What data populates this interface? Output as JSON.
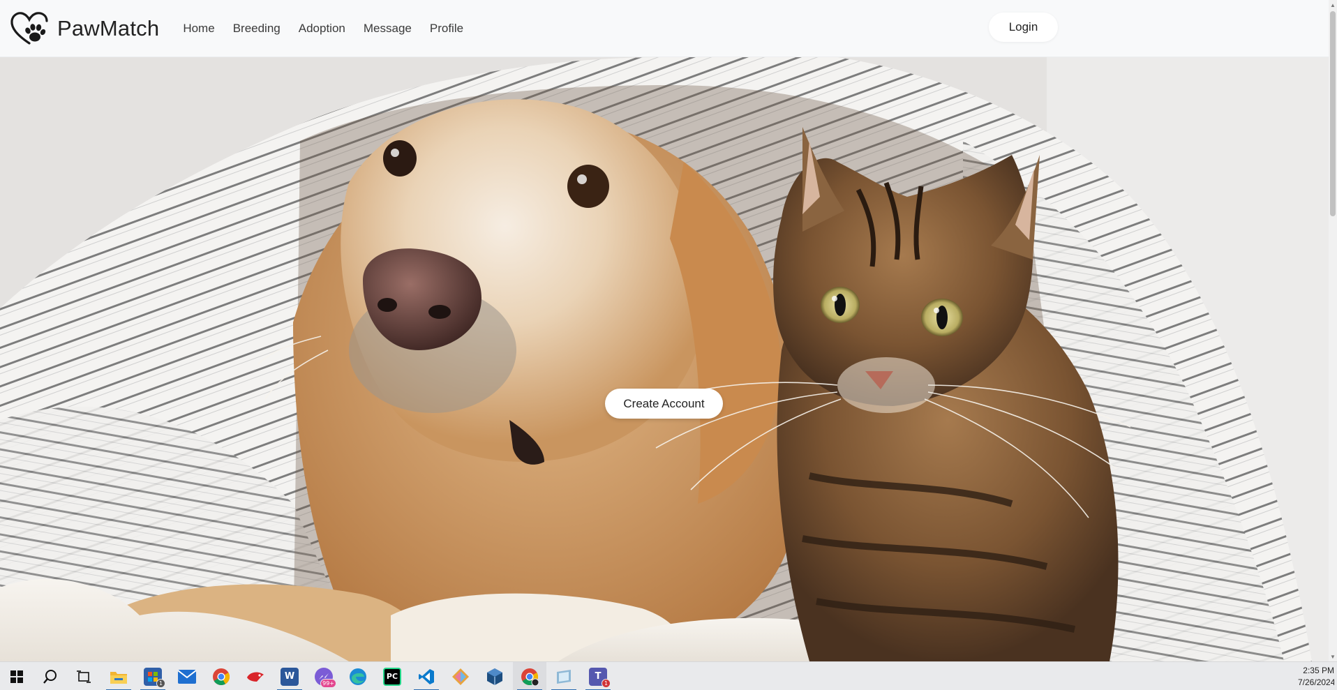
{
  "app": {
    "brand_name": "PawMatch",
    "logo_icon": "heart-paw-icon"
  },
  "nav": {
    "links": [
      {
        "label": "Home"
      },
      {
        "label": "Breeding"
      },
      {
        "label": "Adoption"
      },
      {
        "label": "Message"
      },
      {
        "label": "Profile"
      }
    ],
    "login_label": "Login"
  },
  "hero": {
    "image": "dog-and-cat-under-striped-blanket",
    "cta_label": "Create Account"
  },
  "taskbar": {
    "items": [
      {
        "name": "windows-start-icon"
      },
      {
        "name": "search-icon"
      },
      {
        "name": "task-view-icon"
      },
      {
        "name": "file-explorer-icon",
        "active": true
      },
      {
        "name": "microsoft-store-icon",
        "badge": "1",
        "active": true
      },
      {
        "name": "mail-icon"
      },
      {
        "name": "chrome-icon"
      },
      {
        "name": "red-app-icon"
      },
      {
        "name": "word-icon",
        "label": "W",
        "active": true
      },
      {
        "name": "messenger-icon",
        "badge": "99+"
      },
      {
        "name": "edge-icon"
      },
      {
        "name": "pycharm-icon",
        "label": "PC"
      },
      {
        "name": "vscode-icon",
        "active": true
      },
      {
        "name": "sourcetree-icon"
      },
      {
        "name": "virtualbox-icon"
      },
      {
        "name": "chrome-profile-icon",
        "focused": true,
        "active": true
      },
      {
        "name": "notes-app-icon",
        "active": true
      },
      {
        "name": "teams-icon",
        "label": "T",
        "badge": "1",
        "active": true
      }
    ],
    "clock": {
      "time": "2:35 PM",
      "date": "7/26/2024"
    }
  },
  "colors": {
    "navbar_bg": "#f8f9fa",
    "button_bg": "#ffffff",
    "taskbar_bg": "#e9eaec",
    "accent": "#2b6cb0"
  }
}
